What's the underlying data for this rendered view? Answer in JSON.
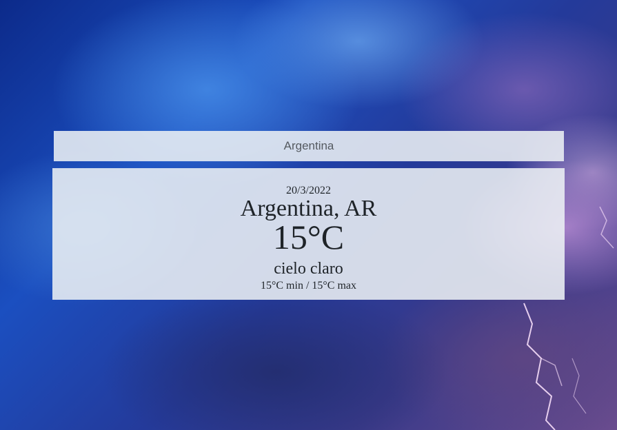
{
  "search": {
    "value": "Argentina"
  },
  "weather": {
    "date": "20/3/2022",
    "location": "Argentina, AR",
    "temperature": "15°C",
    "description": "cielo claro",
    "minmax": "15°C min / 15°C max"
  }
}
